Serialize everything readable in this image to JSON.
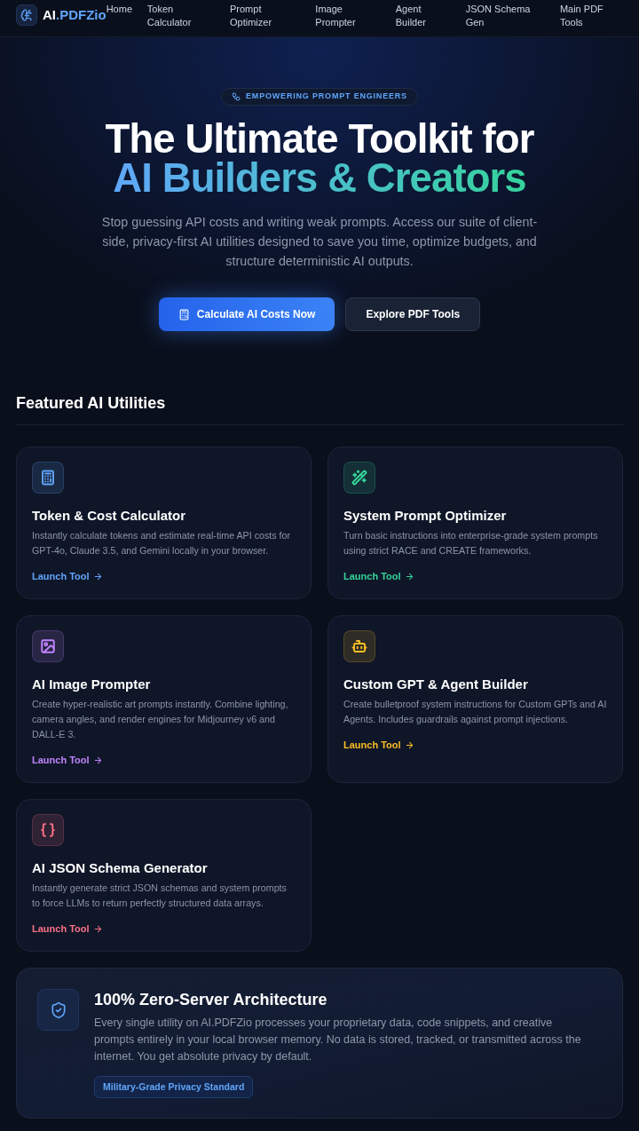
{
  "nav": {
    "brand": {
      "prefix": "AI",
      "suffix": ".PDFZio"
    },
    "links": [
      "Home",
      "Token Calculator",
      "Prompt Optimizer",
      "Image Prompter",
      "Agent Builder",
      "JSON Schema Gen",
      "Main PDF Tools"
    ]
  },
  "hero": {
    "badge": "EMPOWERING PROMPT ENGINEERS",
    "title_line_1": "The Ultimate Toolkit for",
    "title_line_2": "AI Builders & Creators",
    "description": "Stop guessing API costs and writing weak prompts. Access our suite of client-side, privacy-first AI utilities designed to save you time, optimize budgets, and structure deterministic AI outputs.",
    "buttons": [
      {
        "label": "Calculate AI Costs Now",
        "kind": "primary"
      },
      {
        "label": "Explore PDF Tools",
        "kind": "secondary"
      }
    ]
  },
  "featured": {
    "heading": "Featured AI Utilities",
    "tools": [
      {
        "title": "Token & Cost Calculator",
        "description": "Instantly calculate tokens and estimate real-time API costs for GPT-4o, Claude 3.5, and Gemini locally in your browser.",
        "link": "Launch Tool",
        "color": "#60a5fa"
      },
      {
        "title": "System Prompt Optimizer",
        "description": "Turn basic instructions into enterprise-grade system prompts using strict RACE and CREATE frameworks.",
        "link": "Launch Tool",
        "color": "#34d399"
      },
      {
        "title": "AI Image Prompter",
        "description": "Create hyper-realistic art prompts instantly. Combine lighting, camera angles, and render engines for Midjourney v6 and DALL-E 3.",
        "link": "Launch Tool",
        "color": "#c084fc"
      },
      {
        "title": "Custom GPT & Agent Builder",
        "description": "Create bulletproof system instructions for Custom GPTs and AI Agents. Includes guardrails against prompt injections.",
        "link": "Launch Tool",
        "color": "#fbbf24"
      },
      {
        "title": "AI JSON Schema Generator",
        "description": "Instantly generate strict JSON schemas and system prompts to force LLMs to return perfectly structured data arrays.",
        "link": "Launch Tool",
        "color": "#fb7185"
      }
    ]
  },
  "privacy": {
    "title": "100% Zero-Server Architecture",
    "description": "Every single utility on AI.PDFZio processes your proprietary data, code snippets, and creative prompts entirely in your local browser memory. No data is stored, tracked, or transmitted across the internet. You get absolute privacy by default.",
    "badge": "Military-Grade Privacy Standard"
  }
}
